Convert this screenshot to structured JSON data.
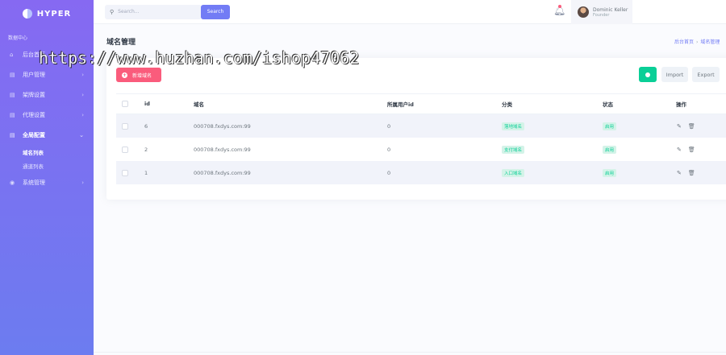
{
  "app": {
    "logo_text": "HYPER"
  },
  "sidebar": {
    "section_title": "数据中心",
    "items": [
      {
        "icon": "dashboard-icon",
        "glyph": "⌂",
        "label": "后台首页",
        "has_chevron": false,
        "active": false
      },
      {
        "icon": "users-icon",
        "glyph": "▤",
        "label": "用户管理",
        "has_chevron": true,
        "active": false
      },
      {
        "icon": "settings-icon",
        "glyph": "▤",
        "label": "架牌设置",
        "has_chevron": true,
        "active": false
      },
      {
        "icon": "agent-icon",
        "glyph": "▤",
        "label": "代理设置",
        "has_chevron": true,
        "active": false
      },
      {
        "icon": "config-icon",
        "glyph": "▤",
        "label": "全局配置",
        "has_chevron": true,
        "active": true
      }
    ],
    "subitems": [
      {
        "label": "域名列表",
        "active": true
      },
      {
        "label": "通道列表",
        "active": false
      }
    ],
    "last_item": {
      "icon": "system-icon",
      "glyph": "◉",
      "label": "系统管理"
    }
  },
  "topbar": {
    "search_placeholder": "Search...",
    "search_button": "Search",
    "user_name": "Dominic Keller",
    "user_role": "Founder"
  },
  "page": {
    "title": "域名管理",
    "breadcrumb": [
      "后台首页",
      "域名管理"
    ]
  },
  "watermark": "https://www.huzhan.com/ishop47062",
  "toolbar": {
    "add_label": "新增域名",
    "import_label": "Import",
    "export_label": "Export"
  },
  "table": {
    "headers": [
      "id",
      "域名",
      "所属用户id",
      "分类",
      "状态",
      "操作"
    ],
    "rows": [
      {
        "id": "6",
        "domain": "000708.fxdys.com:99",
        "user_id": "0",
        "category": "落地域名",
        "status": "启用"
      },
      {
        "id": "2",
        "domain": "000708.fxdys.com:99",
        "user_id": "0",
        "category": "支付域名",
        "status": "启用"
      },
      {
        "id": "1",
        "domain": "000708.fxdys.com:99",
        "user_id": "0",
        "category": "入口域名",
        "status": "启用"
      }
    ]
  },
  "colors": {
    "primary": "#727cf5",
    "danger": "#fa5c7c",
    "success": "#0acf97"
  }
}
